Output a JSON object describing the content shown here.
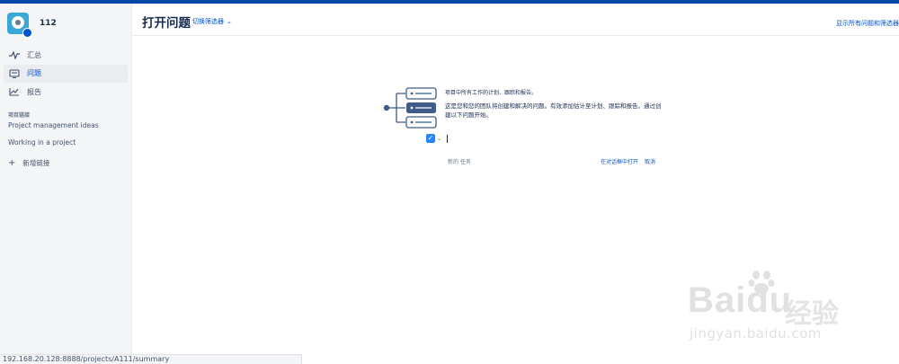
{
  "project": {
    "name": "112"
  },
  "sidebar": {
    "items": [
      {
        "label": "汇总",
        "icon": "pulse-icon",
        "active": false
      },
      {
        "label": "问题",
        "icon": "issues-icon",
        "active": true
      },
      {
        "label": "报告",
        "icon": "chart-icon",
        "active": false
      }
    ],
    "section_title": "项目链接",
    "links": [
      "Project management ideas",
      "Working in a project"
    ],
    "add_link": "新增链接"
  },
  "header": {
    "title": "打开问题",
    "switch_filter": "切换筛选器",
    "show_all": "显示所有问题和筛选器"
  },
  "empty_state": {
    "line1": "项目中所有工作的计划、跟踪和报告。",
    "line2": "这是您和您的团队将创建和解决的问题。有效添加估计至计划、跟踪和报告。通过创建以下问题开始。",
    "hint": "新的 任务",
    "open_dialog": "在对话框中打开",
    "cancel": "取消"
  },
  "status_url": "192.168.20.128:8888/projects/A111/summary",
  "watermark": {
    "brand": "Bai",
    "brand2": "du",
    "cn": "经验",
    "url": "jingyan.baidu.com"
  },
  "colors": {
    "accent": "#0052cc",
    "topbar": "#0747a6",
    "sidebar_bg": "#f4f5f7"
  }
}
